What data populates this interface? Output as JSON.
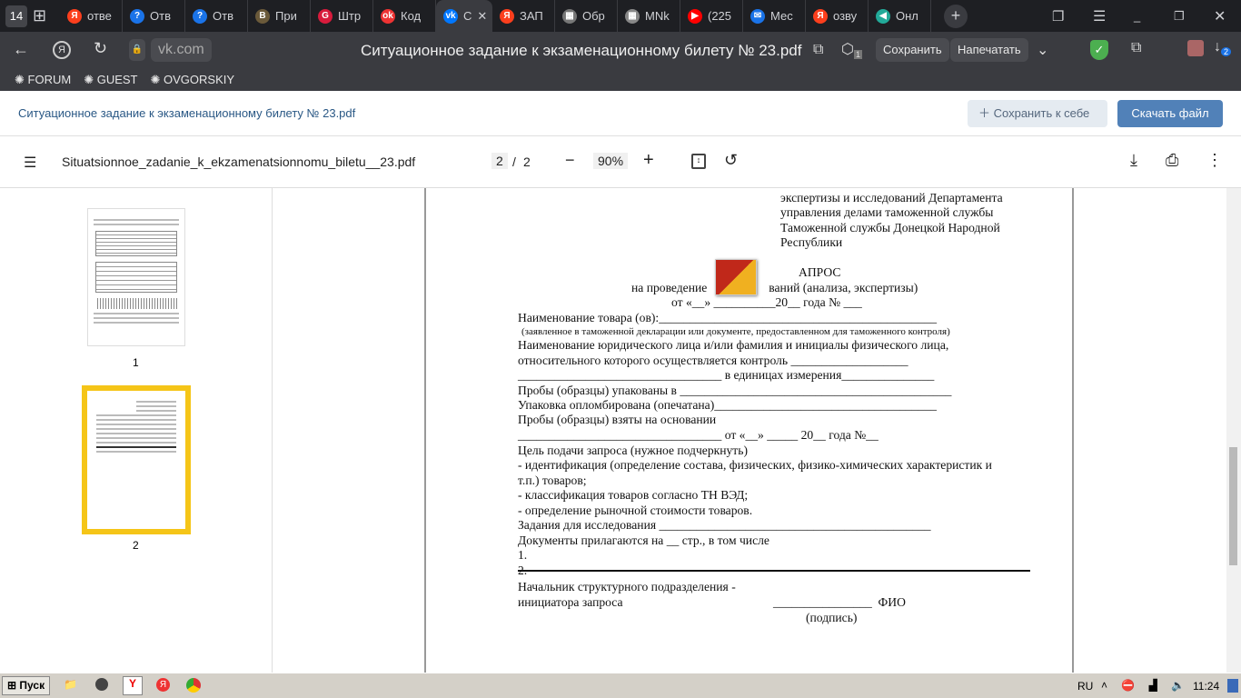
{
  "browser": {
    "tab_count": "14",
    "tabs": [
      {
        "label": "отве",
        "color": "#fc3f1d",
        "glyph": "Я"
      },
      {
        "label": "Отв",
        "color": "#1a73e8",
        "glyph": "?"
      },
      {
        "label": "Отв",
        "color": "#1a73e8",
        "glyph": "?"
      },
      {
        "label": "При",
        "color": "#6b5a3a",
        "glyph": "B"
      },
      {
        "label": "Штр",
        "color": "#d81b3c",
        "glyph": "G"
      },
      {
        "label": "Код",
        "color": "#e33",
        "glyph": "ok"
      },
      {
        "label": "С",
        "color": "#0077ff",
        "glyph": "vk",
        "active": true
      },
      {
        "label": "ЗАП",
        "color": "#fc3f1d",
        "glyph": "Я"
      },
      {
        "label": "Обр",
        "color": "#777",
        "glyph": "▦"
      },
      {
        "label": "MNk",
        "color": "#888",
        "glyph": "▦"
      },
      {
        "label": "(225",
        "color": "#f00",
        "glyph": "▶"
      },
      {
        "label": "Мес",
        "color": "#1a73e8",
        "glyph": "✉"
      },
      {
        "label": "озву",
        "color": "#fc3f1d",
        "glyph": "Я"
      },
      {
        "label": "Онл",
        "color": "#2a9",
        "glyph": "◀"
      }
    ],
    "url": "vk.com",
    "page_title": "Ситуационное задание к экзаменационному билету № 23.pdf",
    "save_label": "Сохранить",
    "print_label": "Напечатать",
    "shield_badge": "1",
    "download_badge": "2",
    "bookmarks": [
      "FORUM",
      "GUEST",
      "OVGORSKIY"
    ]
  },
  "vk": {
    "title": "Ситуационное задание к экзаменационному билету № 23.pdf",
    "save_to_self": "Сохранить к себе",
    "download": "Скачать файл"
  },
  "pdf": {
    "filename": "Situatsionnoe_zadanie_k_ekzamenatsionnomu_biletu__23.pdf",
    "current_page": "2",
    "separator": "/",
    "total_pages": "2",
    "zoom": "90%",
    "thumbnails": [
      {
        "label": "1"
      },
      {
        "label": "2"
      }
    ]
  },
  "document": {
    "lines": [
      "экспертизы и исследований Департамента",
      "управления делами таможенной службы",
      "Таможенной службы Донецкой Народной",
      "Республики",
      "АПРОС",
      "на проведение                    ваний (анализа, экспертизы)",
      "от «__» __________20__ года № ___",
      "Наименование товара (ов):_____________________________________________",
      "(заявленное в таможенной декларации или документе, предоставленном для таможенного контроля)",
      "Наименование юридического лица и/или фамилия и инициалы физического лица,",
      "относительного которого осуществляется контроль ___________________",
      "_________________________________ в единицах измерения_______________",
      "Пробы (образцы) упакованы в ____________________________________________",
      "Упаковка опломбирована (опечатана)____________________________________",
      "Пробы (образцы) взяты на основании",
      "_________________________________ от «__» _____ 20__ года №__",
      "Цель подачи запроса (нужное подчеркнуть)",
      "- идентификация (определение состава, физических, физико-химических характеристик и",
      "т.п.) товаров;",
      "- классификация товаров согласно ТН ВЭД;",
      "- определение рыночной стоимости товаров.",
      "Задания для исследования ____________________________________________",
      "Документы прилагаются на __ стр., в том числе",
      "1.",
      "2.",
      "Начальник структурного подразделения -",
      "инициатора запроса",
      "________________  ФИО",
      "(подпись)"
    ]
  },
  "taskbar": {
    "start": "Пуск",
    "lang": "RU",
    "time": "11:24"
  }
}
